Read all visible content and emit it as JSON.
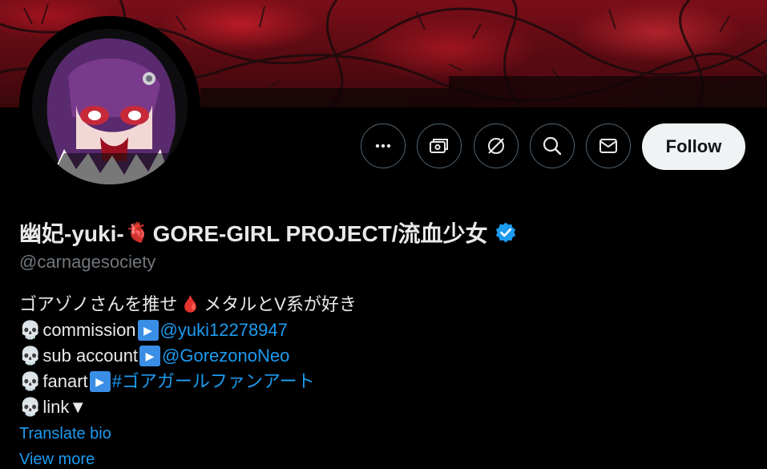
{
  "profile": {
    "name_prefix": "幽妃-yuki-",
    "heart_emoji": "🫀",
    "name_suffix": "GORE-GIRL PROJECT/流血少女",
    "handle": "@carnagesociety",
    "follow_label": "Follow"
  },
  "actions": {
    "more_icon": "more-icon",
    "subscribe_icon": "subscription-icon",
    "grok_icon": "grok-icon",
    "search_icon": "search-icon",
    "message_icon": "envelope-icon"
  },
  "bio": {
    "line1_text": "ゴアゾノさんを推せ",
    "line1_emoji": "🩸",
    "line1_suffix": "メタルとV系が好き",
    "skull": "💀",
    "play": "▶",
    "line2_label": "commission",
    "line2_link": "@yuki12278947",
    "line3_label": "sub account",
    "line3_link": "@GorezonoNeo",
    "line4_label": "fanart",
    "line4_link": "#ゴアガールファンアート",
    "line5_label": "link▼"
  },
  "links": {
    "translate": "Translate bio",
    "view_more": "View more"
  },
  "colors": {
    "background": "#000000",
    "text": "#e7e9ea",
    "muted": "#71767b",
    "link": "#1d9bf0",
    "verified": "#1d9bf0",
    "follow_bg": "#eff3f4",
    "banner_red": "#a1131f"
  }
}
